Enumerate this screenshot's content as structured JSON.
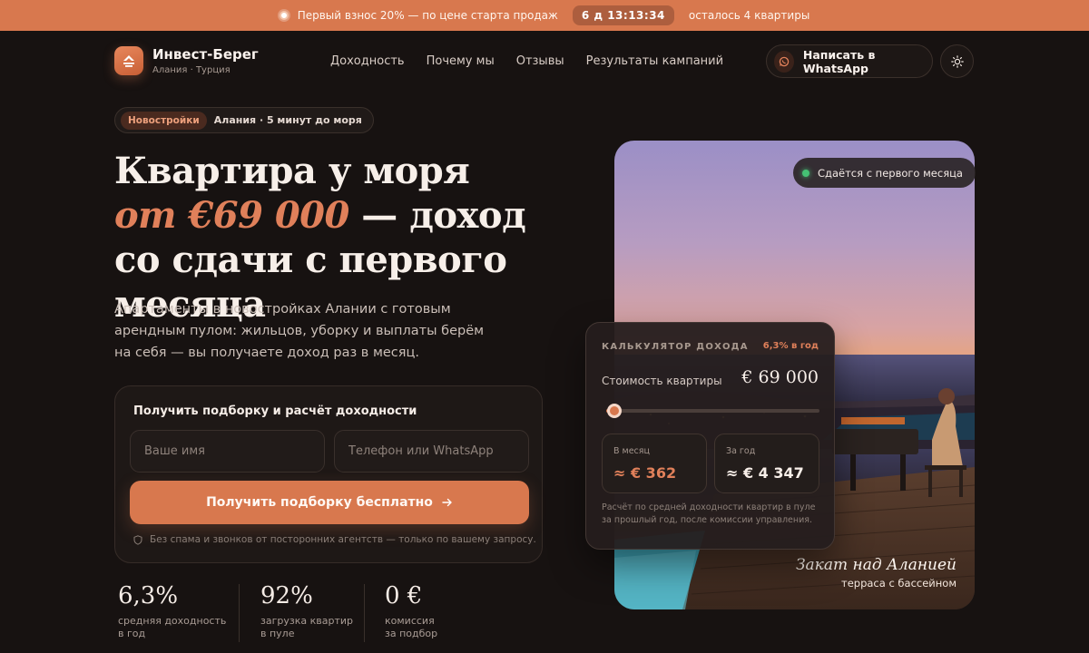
{
  "announcement": {
    "text": "Первый взнос 20% — по цене старта продаж",
    "timer": "6 д 13:13:34",
    "remaining": "осталось 4 квартиры"
  },
  "brand": {
    "name": "Инвест-Берег",
    "location": "Алания · Турция"
  },
  "nav": [
    "Доходность",
    "Почему мы",
    "Отзывы",
    "Результаты кампаний"
  ],
  "header": {
    "whatsapp_label": "Написать в WhatsApp"
  },
  "tag": {
    "pill": "Новостройки",
    "text": "Алания · 5 минут до моря"
  },
  "hero": {
    "line1": "Квартира у моря",
    "accent": "от €69 000",
    "line2_rest": " — доход со сдачи с первого месяца",
    "description": "Апартаменты в новостройках Алании с готовым арендным пулом: жильцов, уборку и выплаты берём на себя — вы получаете доход раз в месяц."
  },
  "form": {
    "title": "Получить подборку и расчёт доходности",
    "name_placeholder": "Ваше имя",
    "phone_placeholder": "Телефон или WhatsApp",
    "submit_label": "Получить подборку бесплатно",
    "note": "Без спама и звонков от посторонних агентств — только по вашему запросу."
  },
  "stats": [
    {
      "value": "6,3%",
      "label1": "средняя доходность",
      "label2": "в год"
    },
    {
      "value": "92%",
      "label1": "загрузка квартир",
      "label2": "в пуле"
    },
    {
      "value": "0 €",
      "label1": "комиссия",
      "label2": "за подбор"
    }
  ],
  "photo": {
    "badge": "Сдаётся с первого месяца",
    "caption_title": "Закат над Аланией",
    "caption_sub": "терраса с бассейном"
  },
  "calculator": {
    "title": "КАЛЬКУЛЯТОР ДОХОДА",
    "rate": "6,3% в год",
    "price_label": "Стоимость квартиры",
    "price_value": "€ 69 000",
    "slider_fraction": 0.04,
    "monthly_label": "В месяц",
    "monthly_value": "≈ € 362",
    "yearly_label": "За год",
    "yearly_value": "≈ € 4 347",
    "footnote": "Расчёт по средней доходности квартир в пуле за прошлый год, после комиссии управления."
  },
  "colors": {
    "accent": "#d8784e",
    "background": "#171211",
    "success": "#45c274"
  }
}
